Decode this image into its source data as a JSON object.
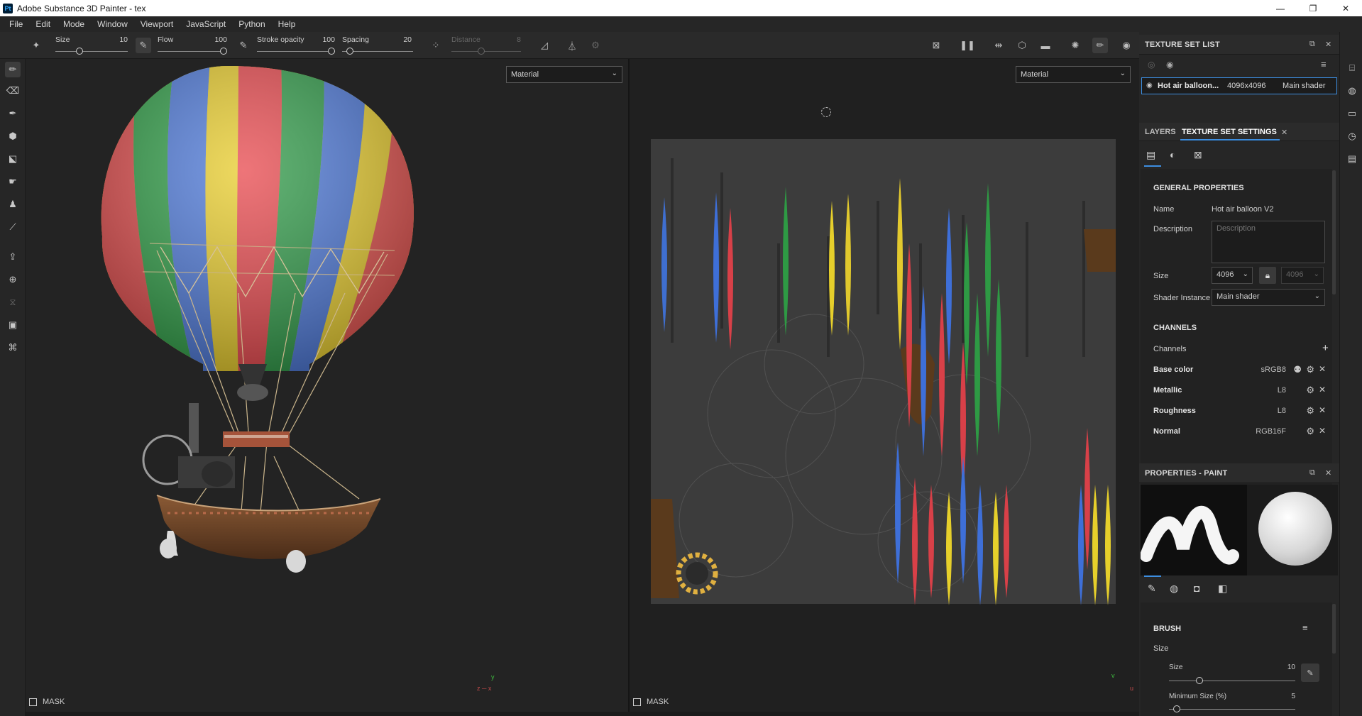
{
  "window": {
    "app_icon": "Pt",
    "title": "Adobe Substance 3D Painter - tex",
    "minimize": "—",
    "maximize": "❐",
    "close": "✕"
  },
  "menu": [
    "File",
    "Edit",
    "Mode",
    "Window",
    "Viewport",
    "JavaScript",
    "Python",
    "Help"
  ],
  "toolbar": {
    "size_label": "Size",
    "size_value": "10",
    "flow_label": "Flow",
    "flow_value": "100",
    "stroke_opacity_label": "Stroke opacity",
    "stroke_opacity_value": "100",
    "spacing_label": "Spacing",
    "spacing_value": "20",
    "distance_label": "Distance",
    "distance_value": "8"
  },
  "viewport_3d": {
    "mode_dropdown": "Material",
    "mask_label": "MASK",
    "axis_y": "y",
    "axis_x": "z ─ x"
  },
  "viewport_2d": {
    "mode_dropdown": "Material",
    "mask_label": "MASK",
    "axis_v": "v",
    "axis_u": "u"
  },
  "texture_set_list": {
    "title": "TEXTURE SET LIST",
    "item": {
      "name": "Hot air balloon...",
      "resolution": "4096x4096",
      "shader": "Main shader"
    }
  },
  "tabs": {
    "layers": "LAYERS",
    "texture_set_settings": "TEXTURE SET SETTINGS",
    "close": "✕"
  },
  "general_properties": {
    "heading": "GENERAL PROPERTIES",
    "name_label": "Name",
    "name_value": "Hot air balloon V2",
    "description_label": "Description",
    "description_placeholder": "Description",
    "size_label": "Size",
    "size_value": "4096",
    "size_value_locked": "4096",
    "shader_label": "Shader Instance",
    "shader_value": "Main shader"
  },
  "channels": {
    "heading": "CHANNELS",
    "label": "Channels",
    "items": [
      {
        "name": "Base color",
        "format": "sRGB8"
      },
      {
        "name": "Metallic",
        "format": "L8"
      },
      {
        "name": "Roughness",
        "format": "L8"
      },
      {
        "name": "Normal",
        "format": "RGB16F"
      }
    ]
  },
  "properties_paint": {
    "title": "PROPERTIES - PAINT",
    "brush_heading": "BRUSH",
    "size_group": "Size",
    "size_label": "Size",
    "size_value": "10",
    "min_size_label": "Minimum Size (%)",
    "min_size_value": "5"
  },
  "colors": {
    "accent": "#3d8ee0",
    "panel": "#262626",
    "viewport": "#232323"
  },
  "icons": [
    "brush-icon",
    "eraser-icon",
    "projection-icon",
    "geometry-fill-icon",
    "polygon-fill-icon",
    "smudge-icon",
    "clone-icon",
    "color-picker-icon",
    "export-icon",
    "bake-icon",
    "eye-icon",
    "lock-icon",
    "gear-icon",
    "plus-icon",
    "close-icon"
  ]
}
